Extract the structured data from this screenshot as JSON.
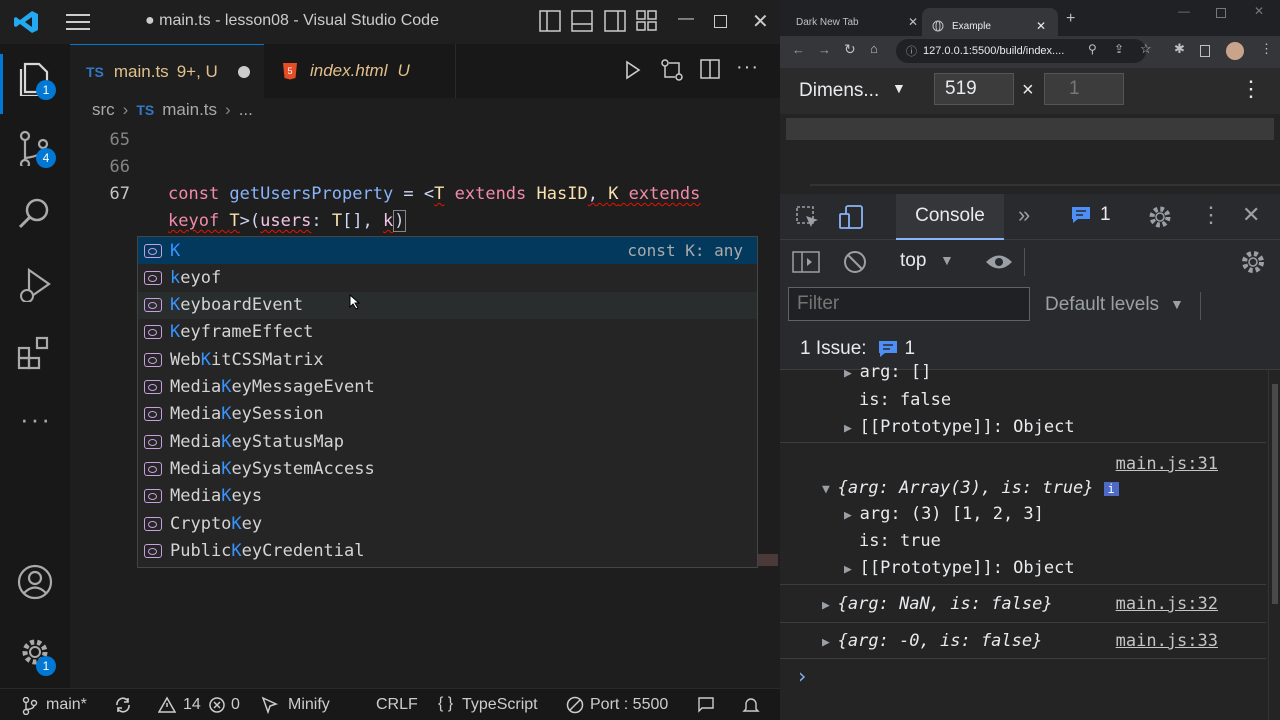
{
  "vscode": {
    "window_title": "● main.ts - lesson08 - Visual Studio Code",
    "tabs": [
      {
        "icon": "TS",
        "name": "main.ts",
        "status": "9+, U"
      },
      {
        "icon": "html5-icon",
        "name": "index.html",
        "status": "U"
      }
    ],
    "breadcrumb": {
      "folder": "src",
      "file_icon": "TS",
      "file": "main.ts",
      "tail": "..."
    },
    "activity_badges": {
      "explorer": "1",
      "source_control": "4",
      "accounts": "1"
    },
    "lines": [
      {
        "num": "65",
        "code": ""
      },
      {
        "num": "66",
        "code": ""
      },
      {
        "num": "67",
        "code": "const getUsersProperty = <T extends HasID, K extends"
      },
      {
        "num": "",
        "code": "keyof T>(users: T[], k)"
      }
    ],
    "code": {
      "const": "const ",
      "fname": "getUsersProperty",
      "eq": " = <",
      "T1": "T",
      "ext1": " extends ",
      "hasid": "HasID",
      "comma1": ", ",
      "K": "K",
      "ext2": " extends",
      "keyof": "keyof ",
      "T2": "T",
      "gt": ">(",
      "users": "users",
      "colon": ": ",
      "T3": "T",
      "arr": "[], ",
      "k": "k",
      "close": ")"
    },
    "suggestions": {
      "detail": "const K: any",
      "items": [
        {
          "pre": "",
          "hl": "K",
          "post": ""
        },
        {
          "pre": "",
          "hl": "k",
          "post": "eyof"
        },
        {
          "pre": "",
          "hl": "K",
          "post": "eyboardEvent"
        },
        {
          "pre": "",
          "hl": "K",
          "post": "eyframeEffect"
        },
        {
          "pre": "Web",
          "hl": "K",
          "post": "itCSSMatrix"
        },
        {
          "pre": "Media",
          "hl": "K",
          "post": "eyMessageEvent"
        },
        {
          "pre": "Media",
          "hl": "K",
          "post": "eySession"
        },
        {
          "pre": "Media",
          "hl": "K",
          "post": "eyStatusMap"
        },
        {
          "pre": "Media",
          "hl": "K",
          "post": "eySystemAccess"
        },
        {
          "pre": "Media",
          "hl": "K",
          "post": "eys"
        },
        {
          "pre": "Crypto",
          "hl": "K",
          "post": "ey"
        },
        {
          "pre": "Public",
          "hl": "K",
          "post": "eyCredential"
        }
      ]
    },
    "status_bar": {
      "branch": "main*",
      "warnings": "14",
      "errors": "0",
      "minify": "Minify",
      "eol": "CRLF",
      "lang": "TypeScript",
      "port": "Port : 5500"
    }
  },
  "chrome": {
    "tabs": [
      {
        "title": "Dark New Tab"
      },
      {
        "title": "Example"
      }
    ],
    "url": "127.0.0.1:5500/build/index....",
    "device_toolbar": {
      "dimensions": "Dimens...",
      "width": "519",
      "times": "×",
      "height": "1"
    },
    "devtools": {
      "console_tab": "Console",
      "issues_badge": "1",
      "context": "top",
      "filter_placeholder": "Filter",
      "levels": "Default levels",
      "issues_label": "1 Issue:",
      "issues_count": "1"
    },
    "console": {
      "arg_empty": "arg: []",
      "is_false": "is: false",
      "proto": "[[Prototype]]: Object",
      "src31": "main.js:31",
      "obj_open": "{arg: Array(3), is: true}",
      "arg_arr": "arg: (3) [1, 2, 3]",
      "is_true": "is: true",
      "proto2": "[[Prototype]]: Object",
      "obj_nan": "{arg: NaN, is: false}",
      "src32": "main.js:32",
      "obj_neg": "{arg: -0, is: false}",
      "src33": "main.js:33",
      "prompt": "›"
    }
  }
}
